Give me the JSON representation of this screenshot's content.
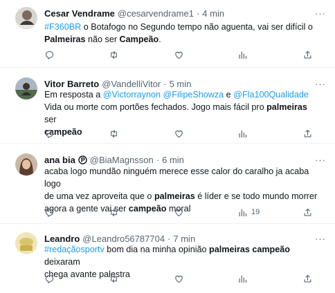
{
  "tweets": [
    {
      "name": "Cesar Vendrame",
      "handle": "@cesarvendrame1",
      "dot": "·",
      "time": "4 min",
      "text": [
        {
          "t": "#F360BR",
          "c": "link"
        },
        {
          "t": " o Botafogo no Segundo tempo não aguenta, vai ser difícil o "
        },
        {
          "t": "\n"
        },
        {
          "t": "Palmeiras",
          "c": "bold"
        },
        {
          "t": " não ser "
        },
        {
          "t": "Campeão",
          "c": "bold"
        },
        {
          "t": "."
        }
      ],
      "views": ""
    },
    {
      "name": "Vitor Barreto",
      "handle": "@VandelliVitor",
      "dot": "·",
      "time": "5 min",
      "text": [
        {
          "t": "Em resposta a "
        },
        {
          "t": "@Victorraynon",
          "c": "link"
        },
        {
          "t": " "
        },
        {
          "t": "@FilipeShowza",
          "c": "link"
        },
        {
          "t": " e "
        },
        {
          "t": "@Fla100Qualidade",
          "c": "link"
        },
        {
          "t": "\n"
        },
        {
          "t": "Vida ou morte com portões fechados. Jogo mais fácil pro "
        },
        {
          "t": "palmeiras",
          "c": "bold"
        },
        {
          "t": " ser"
        },
        {
          "t": "\n"
        },
        {
          "t": "campeão",
          "c": "bold"
        }
      ],
      "views": ""
    },
    {
      "name": "ana bia",
      "handle": "@BiaMagnsson",
      "dot": "·",
      "time": "6 min",
      "text": [
        {
          "t": "acaba logo mundão ninguém merece esse calor do caralho ja acaba logo"
        },
        {
          "t": "\n"
        },
        {
          "t": "de uma vez aproveita que o "
        },
        {
          "t": "palmeiras",
          "c": "bold"
        },
        {
          "t": " é líder e se todo mundo morrer"
        },
        {
          "t": "\n"
        },
        {
          "t": "agora a gente vai ser "
        },
        {
          "t": "campeão",
          "c": "bold"
        },
        {
          "t": " moral"
        }
      ],
      "views": "19"
    },
    {
      "name": "Leandro",
      "handle": "@Leandro56787704",
      "dot": "·",
      "time": "7 min",
      "text": [
        {
          "t": "#redaçãosportv",
          "c": "link"
        },
        {
          "t": " bom dia na minha opinião "
        },
        {
          "t": "palmeiras campeão",
          "c": "bold"
        },
        {
          "t": " deixaram"
        },
        {
          "t": "\n"
        },
        {
          "t": "chega avante palestra"
        }
      ],
      "views": ""
    }
  ],
  "more_label": "···",
  "icons": [
    "reply-icon",
    "retweet-icon",
    "like-icon",
    "views-icon",
    "share-icon",
    "more-icon",
    "verified-badge-icon"
  ],
  "colors": {
    "text": "#0f1419",
    "muted": "#536471",
    "link": "#1d9bf0",
    "divider": "#eff3f4"
  }
}
